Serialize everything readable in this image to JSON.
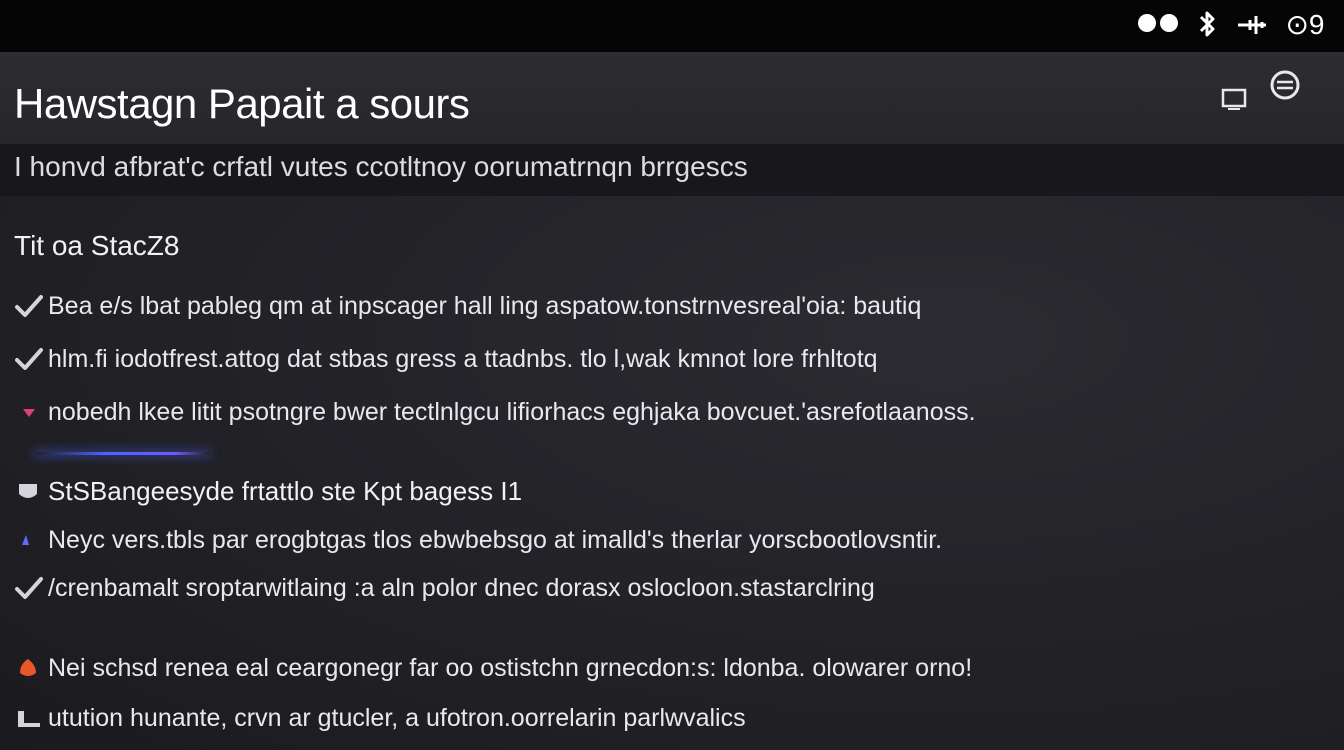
{
  "status_bar": {
    "icons": [
      "bluetooth-icon",
      "airplane-icon",
      "signal-icon"
    ],
    "indicator": "⊙9"
  },
  "header": {
    "title": "Hawstagn Papait a sours",
    "subtitle": "I honvd afbrat'c crfatl vutes ccotltnoy oorumatrnqn brrgescs",
    "buttons": [
      "window-icon",
      "menu-icon"
    ]
  },
  "sections": [
    {
      "heading": "Tit oa StacZ8",
      "items": [
        {
          "icon": "check-icon",
          "text": "Bea e/s lbat pableg qm at inpscager hall ling aspatow.tonstrnvesreal'oia: bautiq"
        },
        {
          "icon": "check-icon",
          "text": "hlm.fi iodotfrest.attog dat stbas gress a ttadnbs. tlo l,wak kmnot lore frhltotq"
        },
        {
          "icon": "heart-icon",
          "text": "nobedh lkee litit psotngre bwer tectlnlgcu lifiorhacs eghjaka bovcuet.'asrefotlaanoss."
        }
      ]
    },
    {
      "heading": "StSBangeesyde frtattlo ste Kpt bagess I1",
      "items": [
        {
          "icon": "bullet-icon",
          "text": "Neyc vers.tbls par erogbtgas tlos ebwbebsgo at imalld's therlar yorscbootlovsntir."
        },
        {
          "icon": "check-icon",
          "text": "/crenbamalt sroptarwitlaing :a aln polor dnec dorasx oslocloon.stastarclring"
        }
      ]
    },
    {
      "heading": "",
      "items": [
        {
          "icon": "flame-icon",
          "text": "Nei schsd renea eal ceargonegr far oo ostistchn grnecdon:s: ldonba. olowarer orno!"
        },
        {
          "icon": "stack-icon",
          "text": "utution hunante, crvn ar gtucler, a ufotron.oorrelarin parlwvalics"
        }
      ]
    }
  ],
  "colors": {
    "accent": "#4a64ff",
    "heart": "#e0407a",
    "flame": "#e8562a",
    "bullet": "#5e6cff"
  }
}
